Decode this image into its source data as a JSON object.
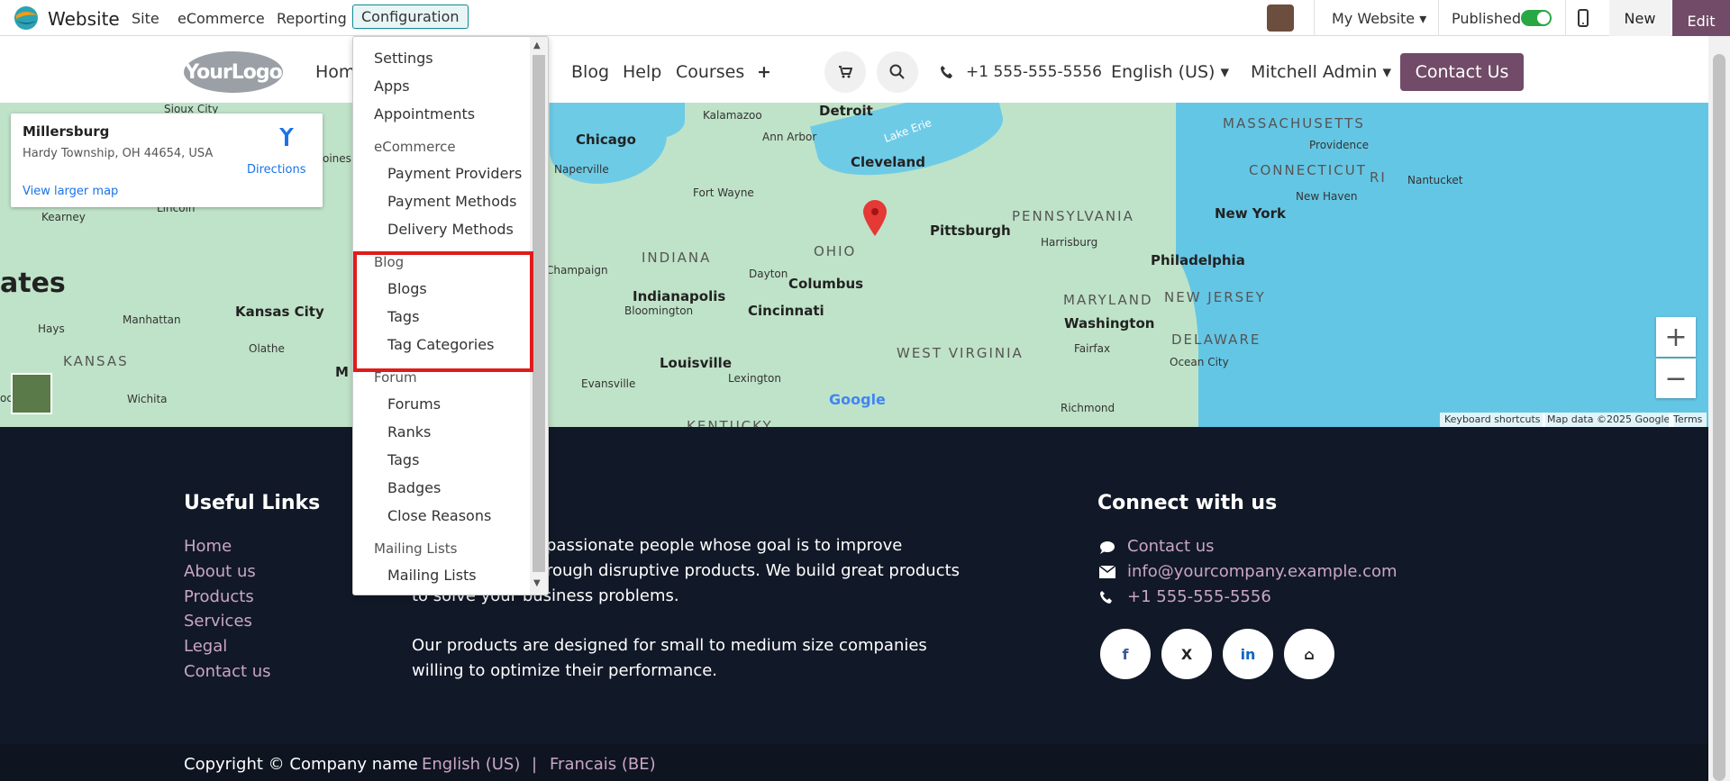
{
  "topbar": {
    "app_name": "Website",
    "menus": [
      "Site",
      "eCommerce",
      "Reporting",
      "Configuration"
    ],
    "website_selector": "My Website",
    "published_label": "Published",
    "new_label": "New",
    "edit_label": "Edit"
  },
  "header": {
    "logo_text": "YourLogo",
    "nav": [
      "Hom",
      "n",
      "Blog",
      "Help",
      "Courses",
      "+"
    ],
    "phone": "+1 555-555-5556",
    "language": "English (US)",
    "user": "Mitchell Admin",
    "contact_btn": "Contact Us"
  },
  "map": {
    "place_title": "Millersburg",
    "place_address": "Hardy Township, OH 44654, USA",
    "larger_map": "View larger map",
    "directions": "Directions",
    "attribution": [
      "Keyboard shortcuts",
      "Map data ©2025 Google",
      "Terms"
    ],
    "google": "Google",
    "labels": {
      "detroit": "Detroit",
      "chicago": "Chicago",
      "cleveland": "Cleveland",
      "ohio": "OHIO",
      "pittsburgh": "Pittsburgh",
      "pennsylvania": "PENNSYLVANIA",
      "newyork": "New York",
      "philadelphia": "Philadelphia",
      "indiana": "INDIANA",
      "indianapolis": "Indianapolis",
      "columbus": "Columbus",
      "cincinnati": "Cincinnati",
      "dayton": "Dayton",
      "louisville": "Louisville",
      "westvirginia": "WEST VIRGINIA",
      "maryland": "MARYLAND",
      "newjersey": "NEW JERSEY",
      "washington": "Washington",
      "delaware": "DELAWARE",
      "massachusetts": "MASSACHUSETTS",
      "connecticut": "CONNECTICUT",
      "ri": "RI",
      "providence": "Providence",
      "newhaven": "New Haven",
      "nantucket": "Nantucket",
      "harrisburg": "Harrisburg",
      "kansascity": "Kansas City",
      "kansas": "KANSAS",
      "manhattan": "Manhattan",
      "hays": "Hays",
      "olathe": "Olathe",
      "wichita": "Wichita",
      "lincoln": "Lincoln",
      "kearney": "Kearney",
      "siouxcity": "Sioux City",
      "naperville": "Naperville",
      "champaign": "Champaign",
      "fortwayne": "Fort Wayne",
      "bloomington": "Bloomington",
      "evansville": "Evansville",
      "lexington": "Lexington",
      "kentucky": "KENTUCKY",
      "richmond": "Richmond",
      "fairfax": "Fairfax",
      "oceancity": "Ocean City",
      "kalamazoo": "Kalamazoo",
      "annarbor": "Ann Arbor",
      "lakeerie": "Lake Erie",
      "ates": "ates",
      "oines": "oines",
      "m": "M",
      "od": "od"
    }
  },
  "dropdown": {
    "items": [
      {
        "type": "item",
        "label": "Settings",
        "indent": 0
      },
      {
        "type": "item",
        "label": "Apps",
        "indent": 0
      },
      {
        "type": "item",
        "label": "Appointments",
        "indent": 0
      },
      {
        "type": "head",
        "label": "eCommerce"
      },
      {
        "type": "item",
        "label": "Payment Providers",
        "indent": 1
      },
      {
        "type": "item",
        "label": "Payment Methods",
        "indent": 1
      },
      {
        "type": "item",
        "label": "Delivery Methods",
        "indent": 1
      },
      {
        "type": "head",
        "label": "Blog"
      },
      {
        "type": "item",
        "label": "Blogs",
        "indent": 1
      },
      {
        "type": "item",
        "label": "Tags",
        "indent": 1
      },
      {
        "type": "item",
        "label": "Tag Categories",
        "indent": 1
      },
      {
        "type": "head",
        "label": "Forum"
      },
      {
        "type": "item",
        "label": "Forums",
        "indent": 1
      },
      {
        "type": "item",
        "label": "Ranks",
        "indent": 1
      },
      {
        "type": "item",
        "label": "Tags",
        "indent": 1
      },
      {
        "type": "item",
        "label": "Badges",
        "indent": 1
      },
      {
        "type": "item",
        "label": "Close Reasons",
        "indent": 1
      },
      {
        "type": "head",
        "label": "Mailing Lists"
      },
      {
        "type": "item",
        "label": "Mailing Lists",
        "indent": 1
      }
    ]
  },
  "footer": {
    "useful_links_title": "Useful Links",
    "useful_links": [
      "Home",
      "About us",
      "Products",
      "Services",
      "Legal",
      "Contact us"
    ],
    "about_lines": [
      "passionate people whose goal is to improve",
      "rough disruptive products. We build great products",
      "to solve your business problems.",
      "Our products are designed for small to medium size companies",
      "willing to optimize their performance."
    ],
    "connect_title": "Connect with us",
    "connect": [
      "Contact us",
      "info@yourcompany.example.com",
      "+1 555-555-5556"
    ],
    "social": [
      "f",
      "X",
      "in",
      "⌂"
    ],
    "copyright": "Copyright © Company name",
    "lang_en": "English (US)",
    "lang_fr": "Francais (BE)",
    "divider": "|"
  },
  "colors": {
    "brand": "#714b67",
    "teal": "#0d8a91",
    "footer_bg": "#111827",
    "link": "#c9a6c4",
    "highlight": "#e01b1b"
  }
}
